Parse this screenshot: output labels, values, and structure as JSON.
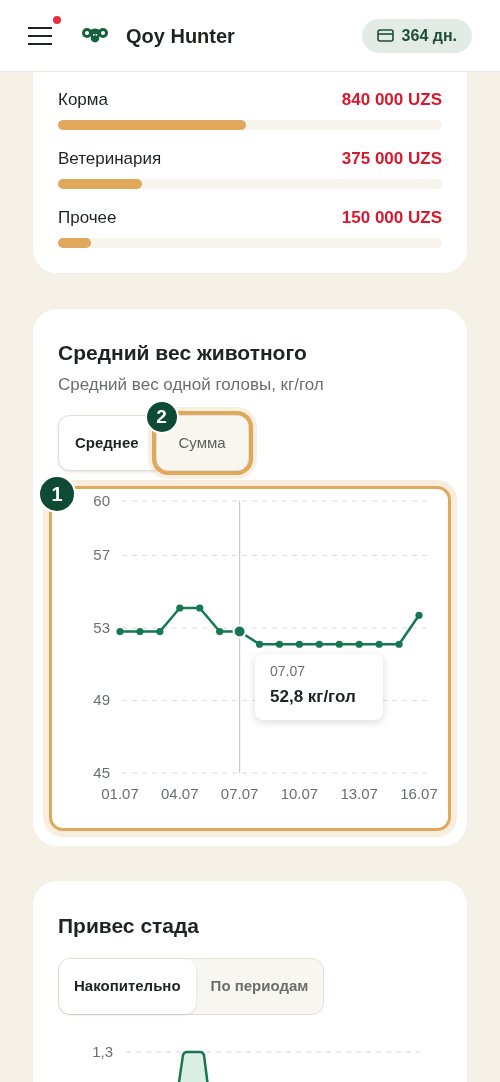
{
  "header": {
    "menu_notification": true,
    "app_name": "Qoy Hunter",
    "subscription_days": "364 дн."
  },
  "expenses": [
    {
      "label": "Корма",
      "amount": "840 000 UZS",
      "level": 0.49
    },
    {
      "label": "Ветеринария",
      "amount": "375 000 UZS",
      "level": 0.22
    },
    {
      "label": "Прочее",
      "amount": "150 000 UZS",
      "level": 0.085
    }
  ],
  "weight_card": {
    "title": "Средний вес животного",
    "subtitle": "Средний вес одной головы, кг/гол",
    "mode_toggle": [
      {
        "label": "Среднее",
        "selected": true,
        "highlighted": false
      },
      {
        "label": "Сумма",
        "selected": false,
        "highlighted": true,
        "tour_mark": "2"
      }
    ],
    "chart_tour_mark": "1",
    "chart_highlighted": true,
    "chart_data": {
      "type": "line",
      "categories": [
        "01.07",
        null,
        null,
        "04.07",
        null,
        null,
        "07.07",
        null,
        null,
        "10.07",
        null,
        null,
        "13.07",
        null,
        null,
        "16.07"
      ],
      "series": [
        {
          "color": "#15784f",
          "marker": "circle",
          "values": [
            52.8,
            52.8,
            52.8,
            54.1,
            54.1,
            52.8,
            52.8,
            52.1,
            52.1,
            52.1,
            52.1,
            52.1,
            52.1,
            52.1,
            52.1,
            53.7
          ]
        }
      ],
      "ylim": [
        45,
        60
      ],
      "yticks": [
        45,
        49,
        53,
        57,
        60
      ],
      "grid": true,
      "ref_lines": [
        {
          "axis": "x",
          "value": "07.07",
          "color": "#c9c9c5"
        }
      ]
    },
    "tooltip": {
      "date": "07.07",
      "value": "52,8 кг/гол"
    }
  },
  "gain_card": {
    "title": "Привес стада",
    "mode_toggle": [
      {
        "label": "Накопительно",
        "selected": true
      },
      {
        "label": "По периодам",
        "selected": false
      }
    ],
    "ytick_label": "1,3"
  }
}
